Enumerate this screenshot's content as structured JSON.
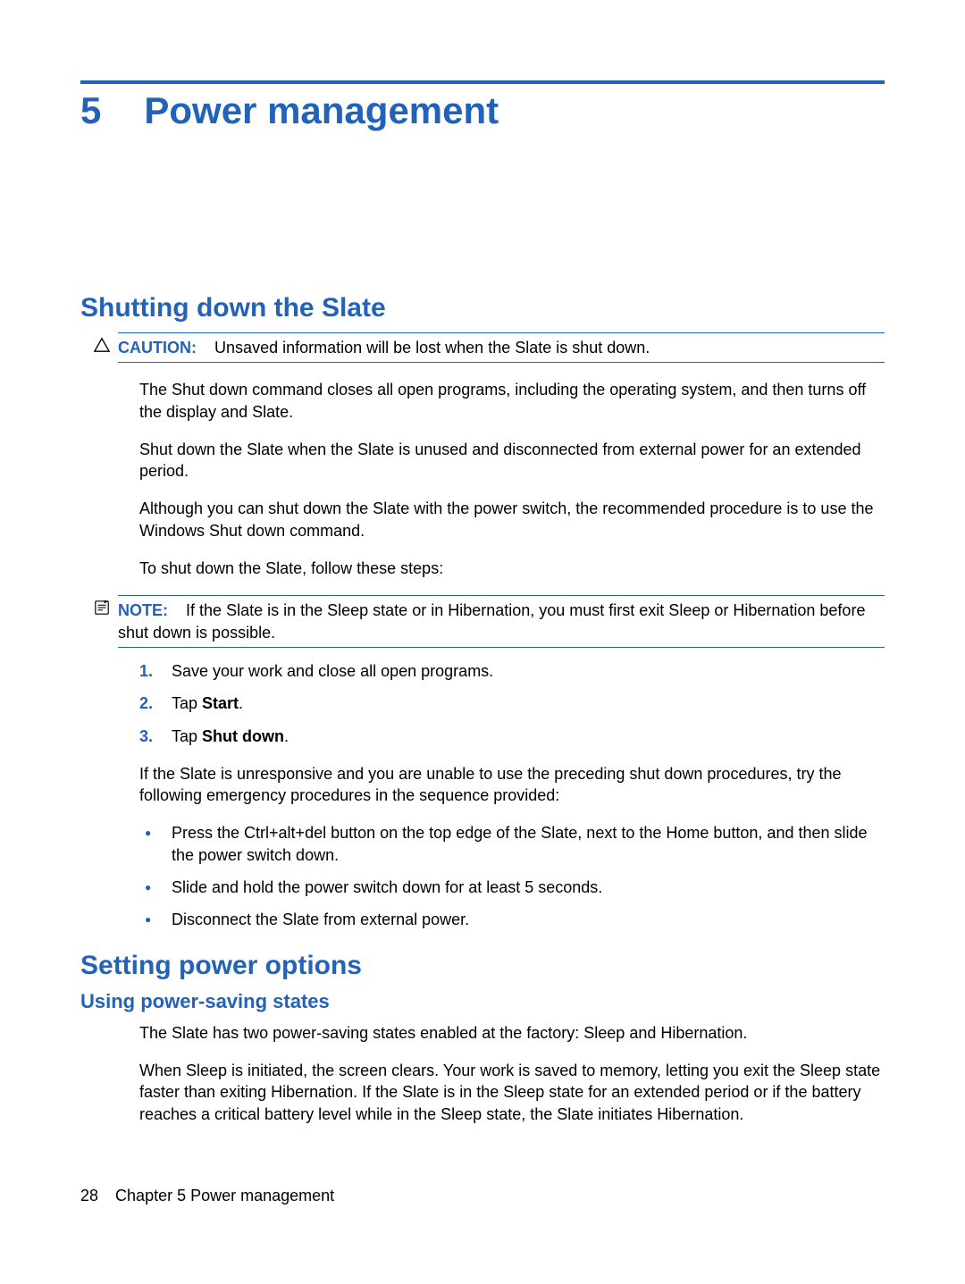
{
  "chapter": {
    "number": "5",
    "title": "Power management"
  },
  "section1": {
    "heading": "Shutting down the Slate",
    "caution": {
      "label": "CAUTION:",
      "text": "Unsaved information will be lost when the Slate is shut down."
    },
    "p1": "The Shut down command closes all open programs, including the operating system, and then turns off the display and Slate.",
    "p2": "Shut down the Slate when the Slate is unused and disconnected from external power for an extended period.",
    "p3": "Although you can shut down the Slate with the power switch, the recommended procedure is to use the Windows Shut down command.",
    "p4": "To shut down the Slate, follow these steps:",
    "note": {
      "label": "NOTE:",
      "text": "If the Slate is in the Sleep state or in Hibernation, you must first exit Sleep or Hibernation before shut down is possible."
    },
    "steps": {
      "s1": {
        "n": "1.",
        "text": "Save your work and close all open programs."
      },
      "s2": {
        "n": "2.",
        "pre": "Tap ",
        "bold": "Start",
        "post": "."
      },
      "s3": {
        "n": "3.",
        "pre": "Tap ",
        "bold": "Shut down",
        "post": "."
      }
    },
    "p5": "If the Slate is unresponsive and you are unable to use the preceding shut down procedures, try the following emergency procedures in the sequence provided:",
    "bullets": {
      "b1": "Press the Ctrl+alt+del button on the top edge of the Slate, next to the Home button, and then slide the power switch down.",
      "b2": "Slide and hold the power switch down for at least 5 seconds.",
      "b3": "Disconnect the Slate from external power."
    }
  },
  "section2": {
    "heading": "Setting power options",
    "sub1": {
      "heading": "Using power-saving states",
      "p1": "The Slate has two power-saving states enabled at the factory: Sleep and Hibernation.",
      "p2": "When Sleep is initiated, the screen clears. Your work is saved to memory, letting you exit the Sleep state faster than exiting Hibernation. If the Slate is in the Sleep state for an extended period or if the battery reaches a critical battery level while in the Sleep state, the Slate initiates Hibernation."
    }
  },
  "footer": {
    "page": "28",
    "label": "Chapter 5   Power management"
  }
}
